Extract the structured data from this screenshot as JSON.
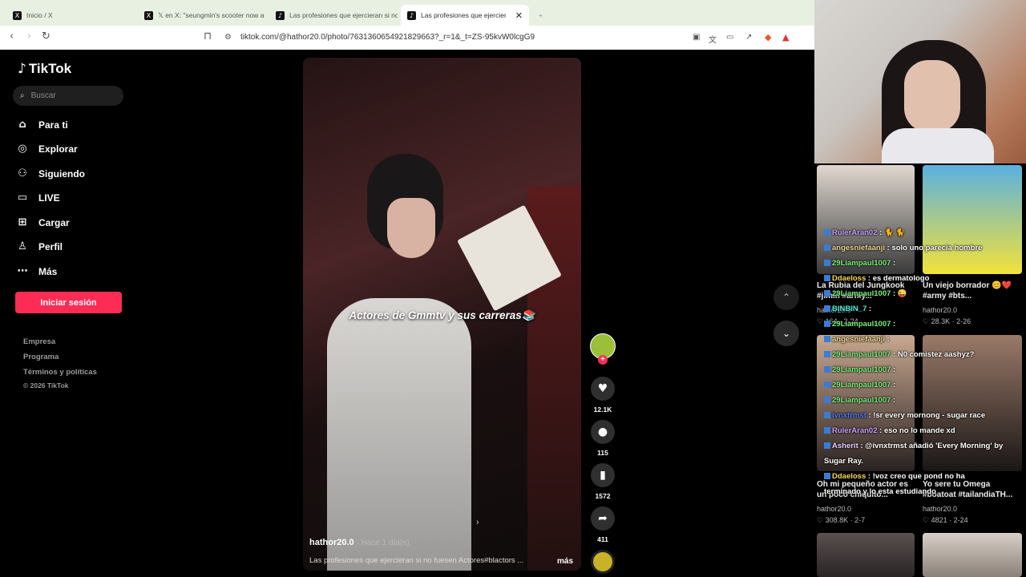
{
  "browser": {
    "tabs": [
      {
        "label": "Inicio / X",
        "icon": "x-icon"
      },
      {
        "label": "𝕏 en X: \"seungmin's scooter now a t",
        "icon": "x-icon"
      },
      {
        "label": "Las profesiones que ejercieran si no",
        "icon": "tiktok-icon"
      },
      {
        "label": "Las profesiones que ejercieran si",
        "icon": "tiktok-icon",
        "active": true
      }
    ],
    "new_tab": "+",
    "url": "tiktok.com/@hathor20.0/photo/7631360654921829663?_r=1&_t=ZS-95kvW0lcgG9"
  },
  "tiktok": {
    "logo": "TikTok",
    "search_placeholder": "Buscar",
    "nav": [
      {
        "label": "Para ti",
        "icon": "home-icon"
      },
      {
        "label": "Explorar",
        "icon": "compass-icon"
      },
      {
        "label": "Siguiendo",
        "icon": "following-icon"
      },
      {
        "label": "LIVE",
        "icon": "live-icon"
      },
      {
        "label": "Cargar",
        "icon": "upload-icon"
      },
      {
        "label": "Perfil",
        "icon": "profile-icon"
      },
      {
        "label": "Más",
        "icon": "more-icon"
      }
    ],
    "login": "Iniciar sesión",
    "footer": [
      "Empresa",
      "Programa",
      "Términos y políticas",
      "© 2026 TikTok"
    ],
    "post": {
      "caption": "Actores de Gmmtv y sus carreras📚",
      "author": "hathor20.0",
      "time": " · Hace 1 día(s)",
      "description": "Las profesiones que ejercieran si no fuesen Actores#blactors ...",
      "more": "más",
      "likes": "12.1K",
      "comments": "115",
      "saves": "1572",
      "shares": "411"
    }
  },
  "recommendations": [
    {
      "title": "La Rubia del Jungkook #jimin #army...",
      "user": "hathor20.0",
      "stats": "164 · 2-24"
    },
    {
      "title": "Un viejo borrador 😊❤️ #army #bts...",
      "user": "hathor20.0",
      "stats": "28.3K · 2-26"
    },
    {
      "title": "Oh mi pequeño actor es un poco chiquito...",
      "user": "hathor20.0",
      "stats": "308.8K · 2-7"
    },
    {
      "title": "Yo sere tu Omega #boatoat #tailandiaTH...",
      "user": "hathor20.0",
      "stats": "4821 · 2-24"
    }
  ],
  "chat": [
    {
      "user": "RulerAran02",
      "color": "#c9a2ff",
      "msg": ": 🐈 🐈"
    },
    {
      "user": "angesniefaanji",
      "color": "#f0d890",
      "msg": ": solo uno parecia hombre"
    },
    {
      "user": "29Liampaul1007",
      "color": "#7cf07c",
      "msg": ":"
    },
    {
      "user": "Ddaeloss",
      "color": "#ffd84a",
      "msg": ": es dermatologo"
    },
    {
      "user": "29Liampaul1007",
      "color": "#7cf07c",
      "msg": ": 😜"
    },
    {
      "user": "BINBIN_7",
      "color": "#4af0e0",
      "msg": ":"
    },
    {
      "user": "29Liampaul1007",
      "color": "#7cf07c",
      "msg": ":"
    },
    {
      "user": "angesniefaanji",
      "color": "#f0d890",
      "msg": ":"
    },
    {
      "user": "29Liampaul1007",
      "color": "#7cf07c",
      "msg": ": N0 comistez aashyz?"
    },
    {
      "user": "29Liampaul1007",
      "color": "#7cf07c",
      "msg": ":"
    },
    {
      "user": "29Liampaul1007",
      "color": "#7cf07c",
      "msg": ":"
    },
    {
      "user": "29Liampaul1007",
      "color": "#7cf07c",
      "msg": ":"
    },
    {
      "user": "ivnxtrmst",
      "color": "#4f7bff",
      "msg": ": !sr every mornong - sugar race"
    },
    {
      "user": "RulerAran02",
      "color": "#c9a2ff",
      "msg": ": eso no lo mande xd"
    },
    {
      "user": "Asherit",
      "color": "#e8d0ff",
      "msg": ": @ivnxtrmst añadió 'Every Morning' by"
    },
    {
      "user": "",
      "color": "#ffffff",
      "msg": "Sugar Ray."
    },
    {
      "user": "Ddaeloss",
      "color": "#ffd84a",
      "msg": ": !voz creo que pond no ha"
    },
    {
      "user": "",
      "color": "#ffffff",
      "msg": "terminado y lo esta estudiando"
    }
  ]
}
